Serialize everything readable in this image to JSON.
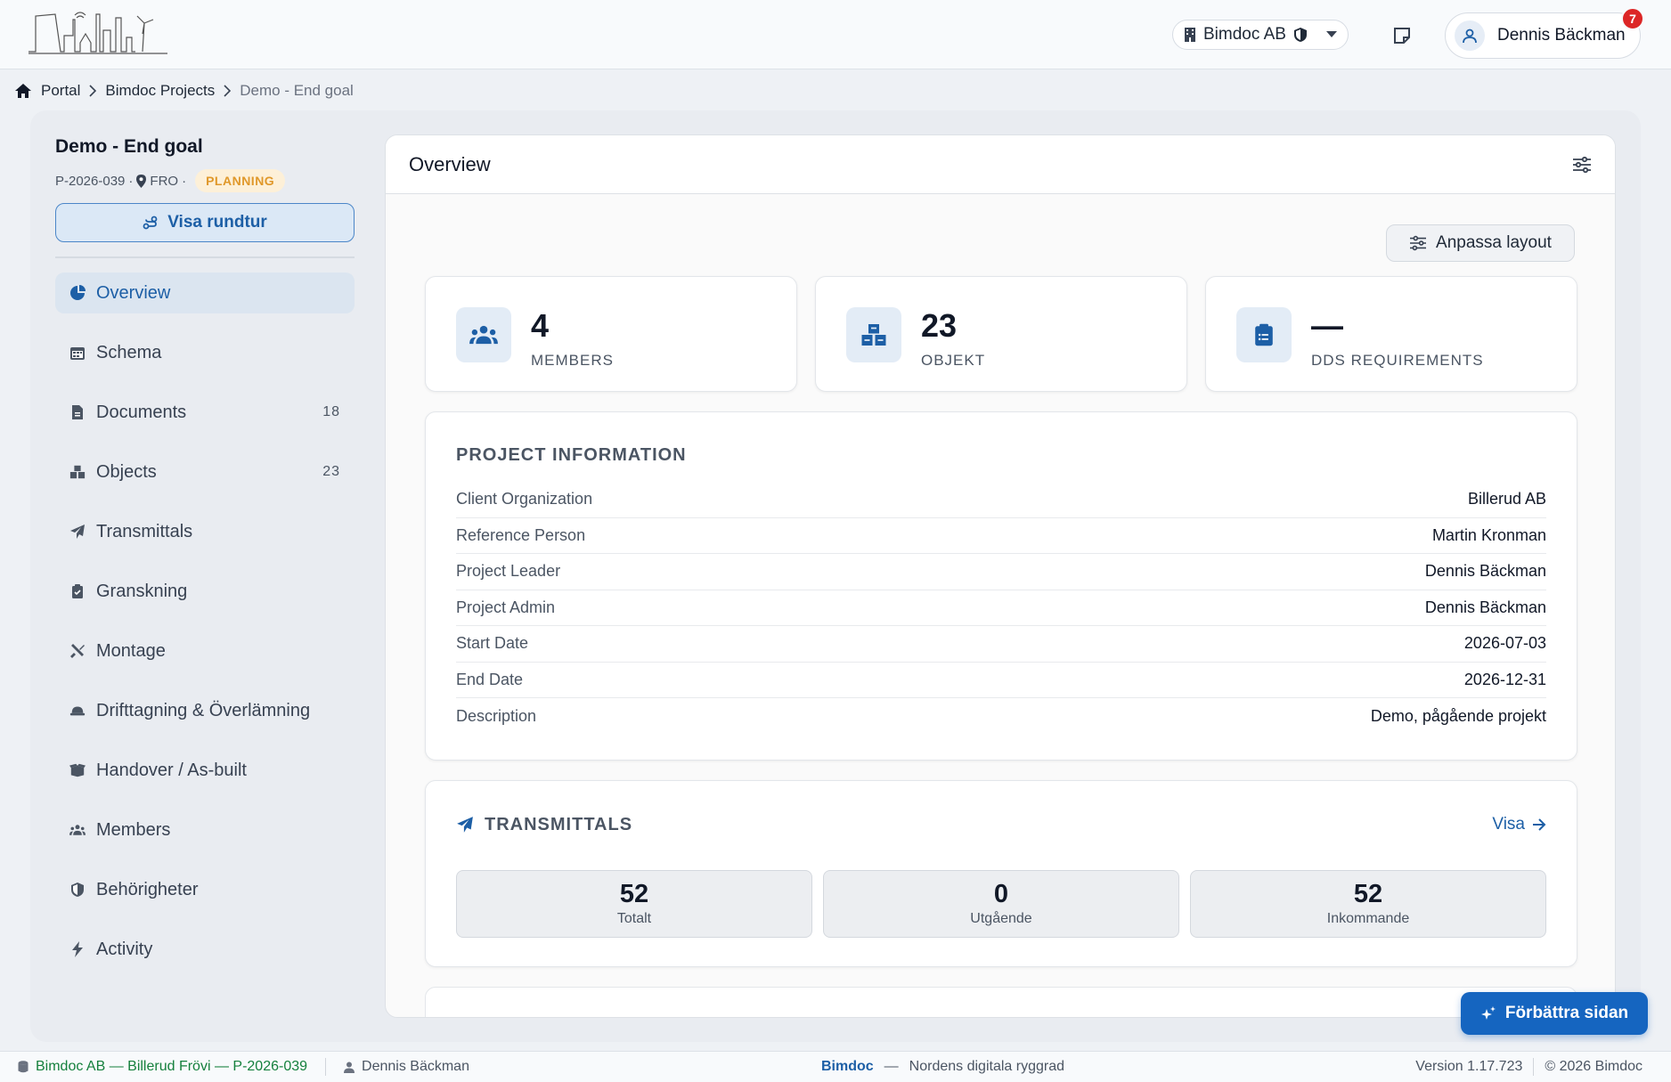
{
  "header": {
    "org_name": "Bimdoc AB",
    "user_name": "Dennis Bäckman",
    "notification_count": "7"
  },
  "breadcrumb": {
    "items": [
      "Portal",
      "Bimdoc Projects",
      "Demo - End goal"
    ]
  },
  "project": {
    "title": "Demo - End goal",
    "code": "P-2026-039",
    "location": "FRO",
    "status": "PLANNING",
    "tour_label": "Visa rundtur"
  },
  "sidebar": {
    "items": [
      {
        "label": "Overview",
        "icon": "pie-chart-icon",
        "count": ""
      },
      {
        "label": "Schema",
        "icon": "calendar-icon",
        "count": ""
      },
      {
        "label": "Documents",
        "icon": "document-icon",
        "count": "18"
      },
      {
        "label": "Objects",
        "icon": "cubes-icon",
        "count": "23"
      },
      {
        "label": "Transmittals",
        "icon": "paper-plane-icon",
        "count": ""
      },
      {
        "label": "Granskning",
        "icon": "clipboard-check-icon",
        "count": ""
      },
      {
        "label": "Montage",
        "icon": "tools-icon",
        "count": ""
      },
      {
        "label": "Drifttagning & Överlämning",
        "icon": "hard-hat-icon",
        "count": ""
      },
      {
        "label": "Handover / As-built",
        "icon": "box-open-icon",
        "count": ""
      },
      {
        "label": "Members",
        "icon": "users-icon",
        "count": ""
      },
      {
        "label": "Behörigheter",
        "icon": "shield-icon",
        "count": ""
      },
      {
        "label": "Activity",
        "icon": "bolt-icon",
        "count": ""
      }
    ]
  },
  "main": {
    "title": "Overview",
    "layout_button": "Anpassa layout",
    "stats": [
      {
        "value": "4",
        "label": "MEMBERS",
        "icon": "users-icon"
      },
      {
        "value": "23",
        "label": "OBJEKT",
        "icon": "cubes-icon"
      },
      {
        "value": "—",
        "label": "DDS REQUIREMENTS",
        "icon": "clipboard-list-icon"
      }
    ],
    "project_info": {
      "title": "PROJECT INFORMATION",
      "rows": [
        {
          "key": "Client Organization",
          "value": "Billerud AB"
        },
        {
          "key": "Reference Person",
          "value": "Martin Kronman"
        },
        {
          "key": "Project Leader",
          "value": "Dennis Bäckman"
        },
        {
          "key": "Project Admin",
          "value": "Dennis Bäckman"
        },
        {
          "key": "Start Date",
          "value": "2026-07-03"
        },
        {
          "key": "End Date",
          "value": "2026-12-31"
        },
        {
          "key": "Description",
          "value": "Demo, pågående projekt"
        }
      ]
    },
    "transmittals": {
      "title": "TRANSMITTALS",
      "link_label": "Visa",
      "boxes": [
        {
          "value": "52",
          "label": "Totalt"
        },
        {
          "value": "0",
          "label": "Utgående"
        },
        {
          "value": "52",
          "label": "Inkommande"
        }
      ]
    }
  },
  "improve_button": "Förbättra sidan",
  "footer": {
    "org_text": "Bimdoc AB — Billerud Frövi — P-2026-039",
    "user": "Dennis Bäckman",
    "brand": "Bimdoc",
    "dash": "—",
    "tagline": "Nordens digitala ryggrad",
    "version": "Version 1.17.723",
    "copyright": "© 2026 Bimdoc"
  },
  "colors": {
    "accent": "#1d5fa6",
    "primary_button": "#1565c0",
    "status_planning": "#e0982a",
    "notification": "#dc2626",
    "footer_org": "#15803d"
  }
}
